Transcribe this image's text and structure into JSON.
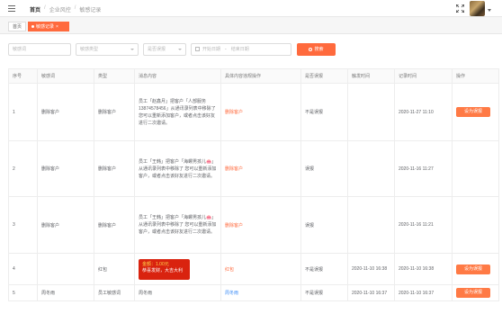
{
  "header": {
    "breadcrumbs": [
      "首页",
      "企业风控",
      "敏感记录"
    ],
    "fullscreen_icon": "fullscreen-icon"
  },
  "tabs": {
    "home": "首页",
    "active": "敏感记录"
  },
  "filters": {
    "word_placeholder": "敏感词",
    "type_placeholder": "敏感类型",
    "misreport_placeholder": "是否误报",
    "start_placeholder": "开始日期",
    "end_placeholder": "结束日期",
    "search_label": "搜索"
  },
  "table": {
    "columns": [
      "序号",
      "敏感词",
      "类型",
      "消息内容",
      "具体内容违规操作",
      "是否误报",
      "触发时间",
      "记录时间",
      "操作"
    ],
    "rows": [
      {
        "index": "1",
        "word": "删除客户",
        "type": "删除客户",
        "message": "员工「赵鑫月」把客户「人部服务13874578456」从通讯录列表中移除了 您可以重新添加客户，或者点击该好友进行二次邀请。",
        "detail": "删除客户",
        "misreport": "不是误报",
        "trigger_time": "",
        "record_time": "2020-11-27 11:10",
        "action": "设为误报"
      },
      {
        "index": "2",
        "word": "删除客户",
        "type": "删除客户",
        "message": "员工「王韩」把客户「海螺男孩儿🐽」从通讯录列表中移除了 您可以重新添加客户，或者点击该好友进行二次邀请。",
        "detail": "删除客户",
        "misreport": "误报",
        "trigger_time": "",
        "record_time": "2020-11-16 11:27",
        "action": ""
      },
      {
        "index": "3",
        "word": "删除客户",
        "type": "删除客户",
        "message": "员工「王韩」把客户「海螺男孩儿🐽」从通讯录列表中移除了 您可以重新添加客户，或者点击该好友进行二次邀请。",
        "detail": "删除客户",
        "misreport": "误报",
        "trigger_time": "",
        "record_time": "2020-11-16 11:21",
        "action": ""
      },
      {
        "index": "4",
        "word": "",
        "type": "红包",
        "message_redpacket": {
          "amount": "金额：1.00元",
          "greeting": "恭喜发财，大吉大利"
        },
        "detail": "红包",
        "misreport": "不是误报",
        "trigger_time": "2020-11-10 16:38",
        "record_time": "2020-11-10 16:38",
        "action": "设为误报"
      },
      {
        "index": "5",
        "word": "周冬雨",
        "type": "员工敏感词",
        "message": "周冬雨",
        "detail": "周冬雨",
        "misreport": "不是误报",
        "trigger_time": "2020-11-10 16:37",
        "record_time": "2020-11-10 16:37",
        "action": "设为误报"
      }
    ]
  }
}
